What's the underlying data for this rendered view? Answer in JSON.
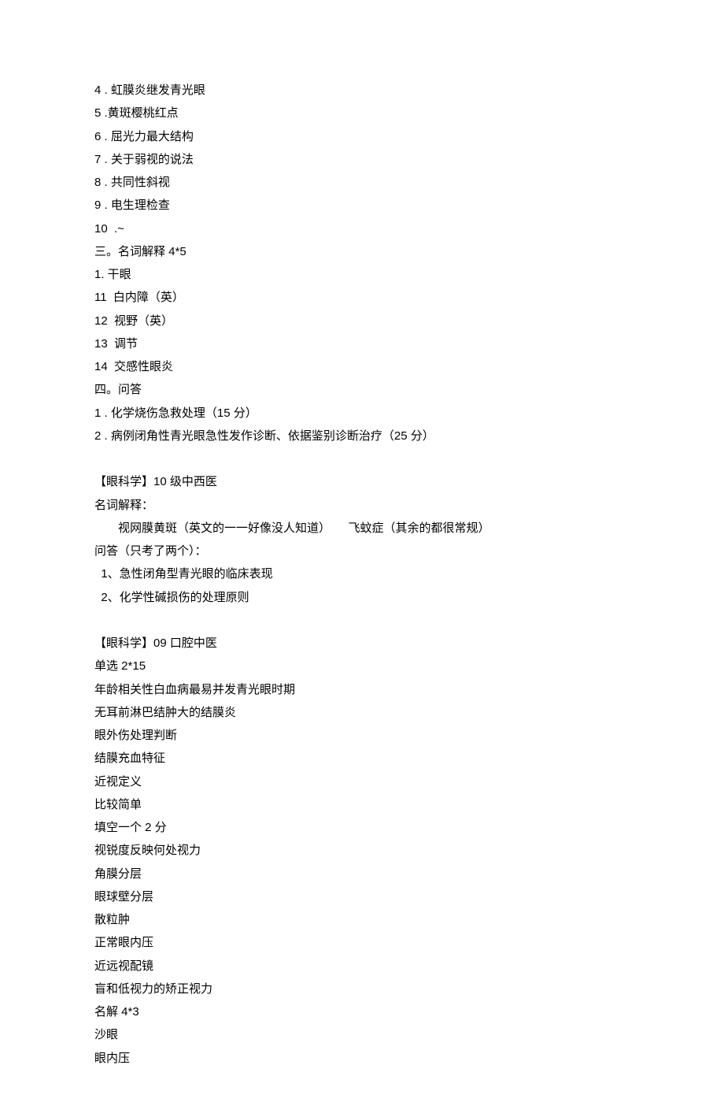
{
  "lines": [
    {
      "text": "4 . 虹膜炎继发青光眼",
      "class": ""
    },
    {
      "text": "5 .黄斑樱桃红点",
      "class": ""
    },
    {
      "text": "6 . 屈光力最大结构",
      "class": ""
    },
    {
      "text": "7 . 关于弱视的说法",
      "class": ""
    },
    {
      "text": "8 . 共同性斜视",
      "class": ""
    },
    {
      "text": "9 . 电生理检查",
      "class": ""
    },
    {
      "text": "10  .~",
      "class": ""
    },
    {
      "text": "三。名词解释 4*5",
      "class": ""
    },
    {
      "text": "1. 干眼",
      "class": ""
    },
    {
      "text": "11  白内障（英）",
      "class": ""
    },
    {
      "text": "12  视野（英）",
      "class": ""
    },
    {
      "text": "13  调节",
      "class": ""
    },
    {
      "text": "14  交感性眼炎",
      "class": ""
    },
    {
      "text": "四。问答",
      "class": ""
    },
    {
      "text": "1 . 化学烧伤急救处理（15 分）",
      "class": ""
    },
    {
      "text": "2 . 病例闭角性青光眼急性发作诊断、依据鉴别诊断治疗（25 分）",
      "class": ""
    },
    {
      "text": "【眼科学】10 级中西医",
      "class": "section-gap"
    },
    {
      "text": "名词解释：",
      "class": ""
    },
    {
      "text": "视网膜黄斑（英文的一一好像没人知道）　　飞蚊症（其余的都很常规）",
      "class": "indent"
    },
    {
      "text": "问答（只考了两个）：",
      "class": ""
    },
    {
      "text": "  1、急性闭角型青光眼的临床表现",
      "class": ""
    },
    {
      "text": "  2、化学性碱损伤的处理原则",
      "class": ""
    },
    {
      "text": "【眼科学】09 口腔中医",
      "class": "section-gap"
    },
    {
      "text": "单选 2*15",
      "class": ""
    },
    {
      "text": "年龄相关性白血病最易并发青光眼时期",
      "class": ""
    },
    {
      "text": "无耳前淋巴结肿大的结膜炎",
      "class": ""
    },
    {
      "text": "眼外伤处理判断",
      "class": ""
    },
    {
      "text": "结膜充血特征",
      "class": ""
    },
    {
      "text": "近视定义",
      "class": ""
    },
    {
      "text": "比较简单",
      "class": ""
    },
    {
      "text": "填空一个 2 分",
      "class": ""
    },
    {
      "text": "视锐度反映何处视力",
      "class": ""
    },
    {
      "text": "角膜分层",
      "class": ""
    },
    {
      "text": "眼球壁分层",
      "class": ""
    },
    {
      "text": "散粒肿",
      "class": ""
    },
    {
      "text": "正常眼内压",
      "class": ""
    },
    {
      "text": "近远视配镜",
      "class": ""
    },
    {
      "text": "盲和低视力的矫正视力",
      "class": ""
    },
    {
      "text": "名解 4*3",
      "class": ""
    },
    {
      "text": "沙眼",
      "class": ""
    },
    {
      "text": "眼内压",
      "class": ""
    }
  ]
}
